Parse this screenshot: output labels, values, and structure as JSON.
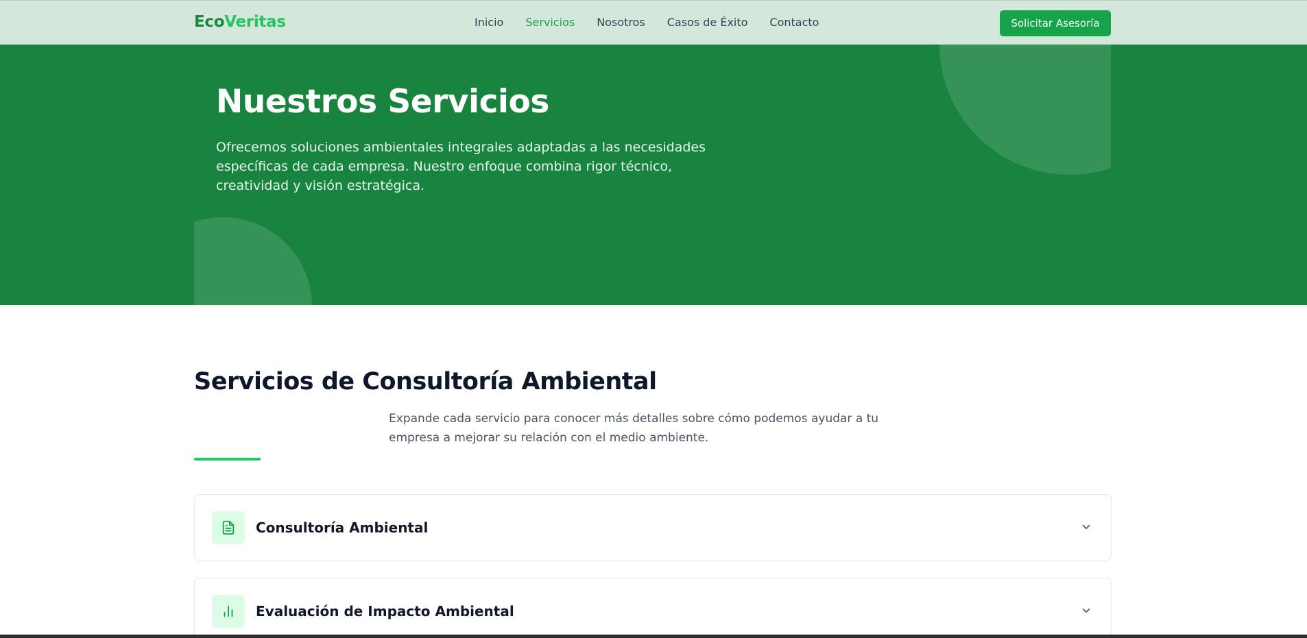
{
  "brand": {
    "part1": "Eco",
    "part2": "Veritas"
  },
  "nav": {
    "links": [
      {
        "label": "Inicio",
        "active": false
      },
      {
        "label": "Servicios",
        "active": true
      },
      {
        "label": "Nosotros",
        "active": false
      },
      {
        "label": "Casos de Éxito",
        "active": false
      },
      {
        "label": "Contacto",
        "active": false
      }
    ],
    "cta_label": "Solicitar Asesoría"
  },
  "hero": {
    "title": "Nuestros Servicios",
    "description": "Ofrecemos soluciones ambientales integrales adaptadas a las necesidades específicas de cada empresa. Nuestro enfoque combina rigor técnico, creatividad y visión estratégica."
  },
  "section": {
    "title": "Servicios de Consultoría Ambiental",
    "description": "Expande cada servicio para conocer más detalles sobre cómo podemos ayudar a tu empresa a mejorar su relación con el medio ambiente."
  },
  "services": [
    {
      "title": "Consultoría Ambiental",
      "icon": "document-icon"
    },
    {
      "title": "Evaluación de Impacto Ambiental",
      "icon": "bar-chart-icon"
    }
  ],
  "colors": {
    "brand_green": "#16a34a",
    "hero_bg": "#188440",
    "navbar_bg": "#d3e8da",
    "accent_light": "#22c55e",
    "icon_bg": "#dcfce7"
  }
}
